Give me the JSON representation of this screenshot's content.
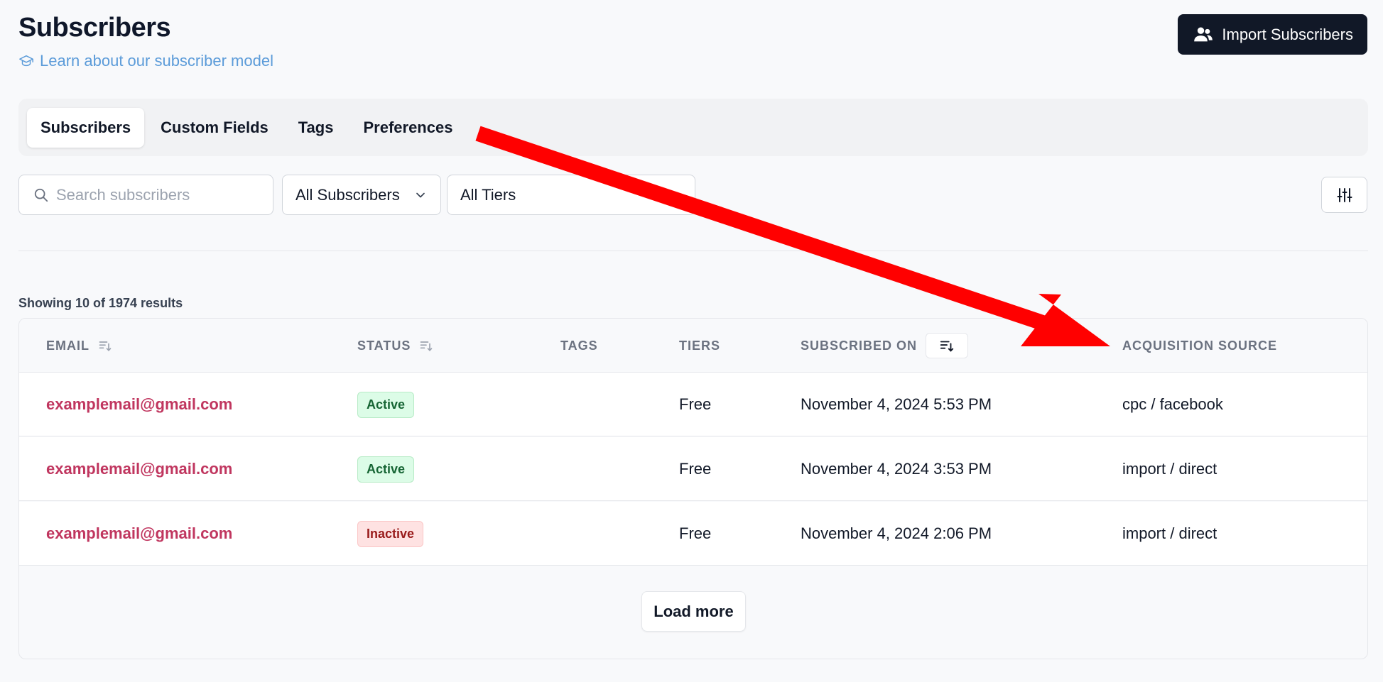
{
  "header": {
    "title": "Subscribers",
    "learn_link": "Learn about our subscriber model",
    "import_button": "Import Subscribers"
  },
  "tabs": [
    {
      "label": "Subscribers",
      "active": true
    },
    {
      "label": "Custom Fields",
      "active": false
    },
    {
      "label": "Tags",
      "active": false
    },
    {
      "label": "Preferences",
      "active": false
    }
  ],
  "filters": {
    "search_placeholder": "Search subscribers",
    "search_value": "",
    "status_filter": "All Subscribers",
    "tier_filter": "All Tiers"
  },
  "results_text": "Showing 10 of 1974 results",
  "table": {
    "columns": [
      "EMAIL",
      "STATUS",
      "TAGS",
      "TIERS",
      "SUBSCRIBED ON",
      "ACQUISITION SOURCE"
    ],
    "rows": [
      {
        "email": "examplemail@gmail.com",
        "status": "Active",
        "tags": "",
        "tier": "Free",
        "subscribed_on": "November 4, 2024 5:53 PM",
        "source": "cpc / facebook"
      },
      {
        "email": "examplemail@gmail.com",
        "status": "Active",
        "tags": "",
        "tier": "Free",
        "subscribed_on": "November 4, 2024 3:53 PM",
        "source": "import / direct"
      },
      {
        "email": "examplemail@gmail.com",
        "status": "Inactive",
        "tags": "",
        "tier": "Free",
        "subscribed_on": "November 4, 2024 2:06 PM",
        "source": "import / direct"
      }
    ]
  },
  "load_more": "Load more",
  "colors": {
    "primary_button": "#111827",
    "link": "#5b9bd9",
    "email": "#c0365f",
    "active_badge": "#dcfce7",
    "inactive_badge": "#fee2e2",
    "annotation_arrow": "#ff0000"
  },
  "icons": {
    "learn": "graduation-cap-icon",
    "import": "users-icon",
    "search": "search-icon",
    "select": "chevron-down-icon",
    "settings": "sliders-icon",
    "sort": "sort-icon"
  }
}
